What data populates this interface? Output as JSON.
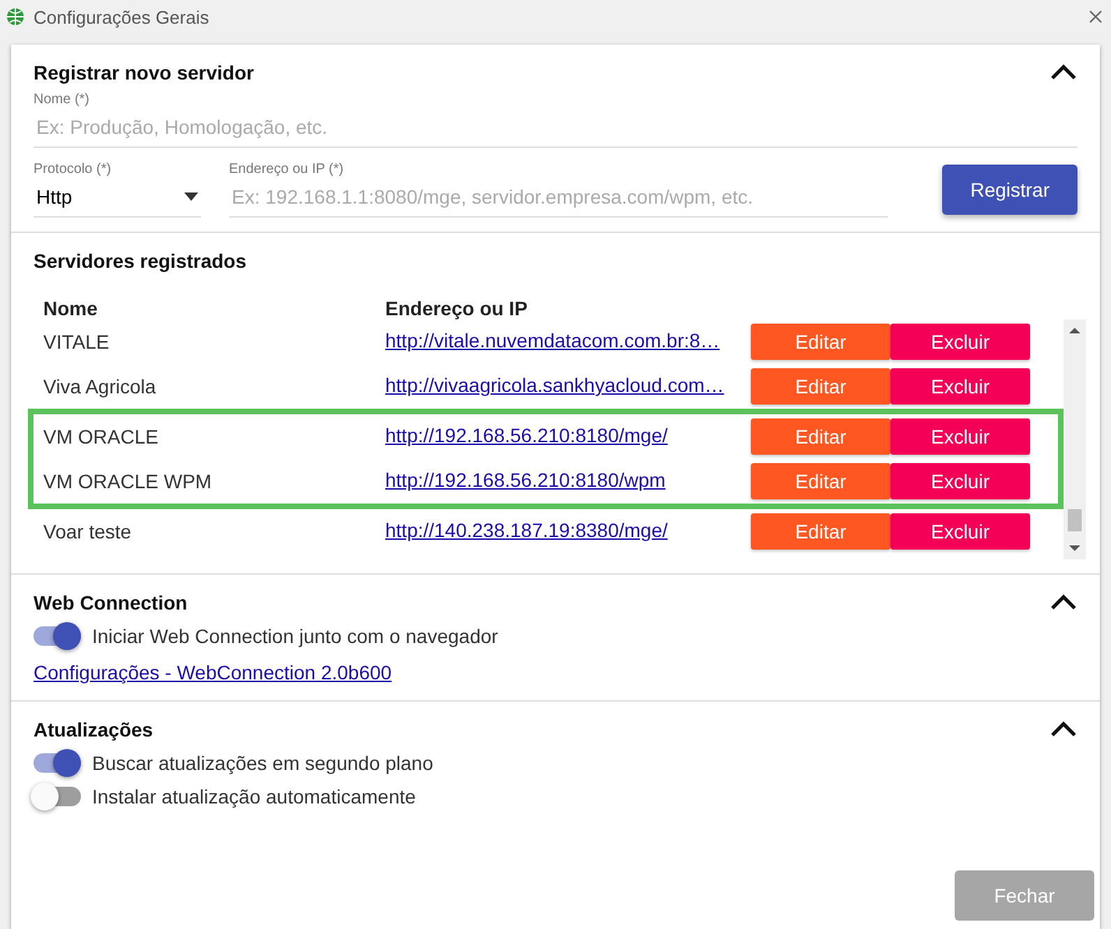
{
  "window": {
    "title": "Configurações Gerais"
  },
  "register": {
    "title": "Registrar novo servidor",
    "name_field": {
      "label": "Nome (*)",
      "placeholder": "Ex: Produção, Homologação, etc."
    },
    "protocol_field": {
      "label": "Protocolo (*)",
      "value": "Http"
    },
    "address_field": {
      "label": "Endereço ou IP (*)",
      "placeholder": "Ex: 192.168.1.1:8080/mge, servidor.empresa.com/wpm, etc."
    },
    "submit": "Registrar"
  },
  "servers": {
    "title": "Servidores registrados",
    "columns": [
      "Nome",
      "Endereço ou IP"
    ],
    "rows": [
      {
        "name": "VITALE",
        "address": "http://vitale.nuvemdatacom.com.br:8…",
        "edit": "Editar",
        "delete": "Excluir",
        "highlighted": false
      },
      {
        "name": "Viva Agricola",
        "address": "http://vivaagricola.sankhyacloud.com…",
        "edit": "Editar",
        "delete": "Excluir",
        "highlighted": false
      },
      {
        "name": "VM ORACLE",
        "address": "http://192.168.56.210:8180/mge/",
        "edit": "Editar",
        "delete": "Excluir",
        "highlighted": true
      },
      {
        "name": "VM ORACLE WPM",
        "address": "http://192.168.56.210:8180/wpm",
        "edit": "Editar",
        "delete": "Excluir",
        "highlighted": true
      },
      {
        "name": "Voar teste",
        "address": "http://140.238.187.19:8380/mge/",
        "edit": "Editar",
        "delete": "Excluir",
        "highlighted": false
      }
    ]
  },
  "web_connection": {
    "title": "Web Connection",
    "toggles": [
      {
        "label": "Iniciar Web Connection junto com o navegador",
        "on": true
      }
    ],
    "link": "Configurações - WebConnection 2.0b600"
  },
  "updates": {
    "title": "Atualizações",
    "toggles": [
      {
        "label": "Buscar atualizações em segundo plano",
        "on": true
      },
      {
        "label": "Instalar atualização automaticamente",
        "on": false
      }
    ]
  },
  "close_button": "Fechar"
}
